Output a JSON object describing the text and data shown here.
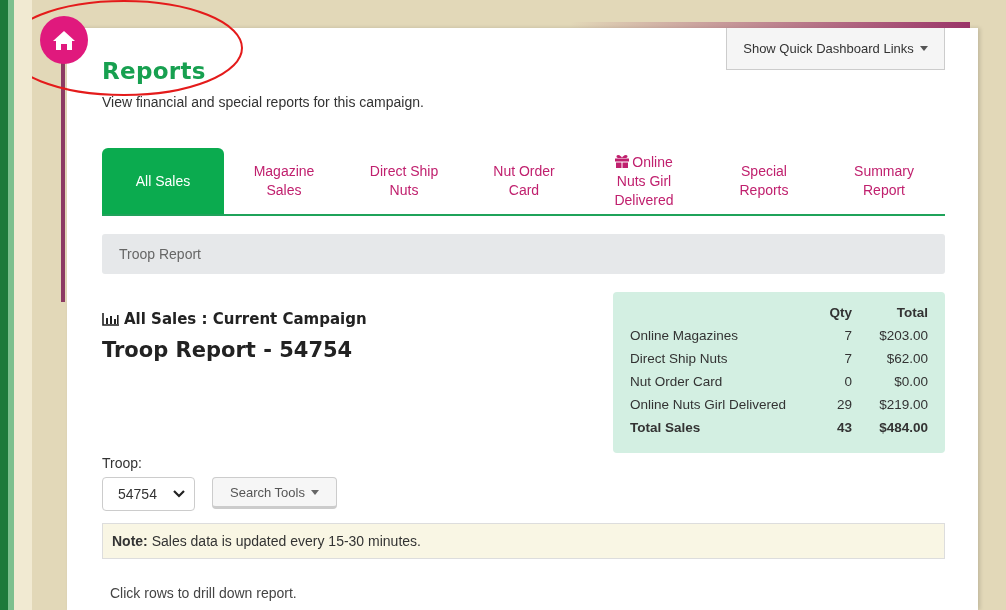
{
  "header": {
    "title": "Reports",
    "subtitle": "View financial and special reports for this campaign.",
    "quick_links_button": "Show Quick Dashboard Links"
  },
  "tabs": [
    {
      "label": "All Sales",
      "selected": true,
      "kind": "plain"
    },
    {
      "label": "Magazine Sales",
      "selected": false,
      "kind": "plain"
    },
    {
      "label": "Direct Ship Nuts",
      "selected": false,
      "kind": "plain"
    },
    {
      "label": "Nut Order Card",
      "selected": false,
      "kind": "plain"
    },
    {
      "label": "Online Nuts Girl Delivered",
      "selected": false,
      "kind": "gift"
    },
    {
      "label": "Special Reports",
      "selected": false,
      "kind": "plain"
    },
    {
      "label": "Summary Report",
      "selected": false,
      "kind": "plain"
    }
  ],
  "report_bar": "Troop Report",
  "section": {
    "subtitle": "All Sales : Current Campaign",
    "title": "Troop Report - 54754"
  },
  "summary": {
    "columns": [
      "Qty",
      "Total"
    ],
    "rows": [
      {
        "label": "Online Magazines",
        "qty": "7",
        "total": "$203.00",
        "kind": "item"
      },
      {
        "label": "Direct Ship Nuts",
        "qty": "7",
        "total": "$62.00",
        "kind": "item"
      },
      {
        "label": "Nut Order Card",
        "qty": "0",
        "total": "$0.00",
        "kind": "item"
      },
      {
        "label": "Online Nuts Girl Delivered",
        "qty": "29",
        "total": "$219.00",
        "kind": "item"
      },
      {
        "label": "Total Sales",
        "qty": "43",
        "total": "$484.00",
        "kind": "total"
      }
    ]
  },
  "filters": {
    "troop_label": "Troop:",
    "troop_value": "54754",
    "search_tools": "Search Tools"
  },
  "note": "**Note:** Sales data is updated every 15-30 minutes.",
  "hint": "Click rows to drill down report."
}
